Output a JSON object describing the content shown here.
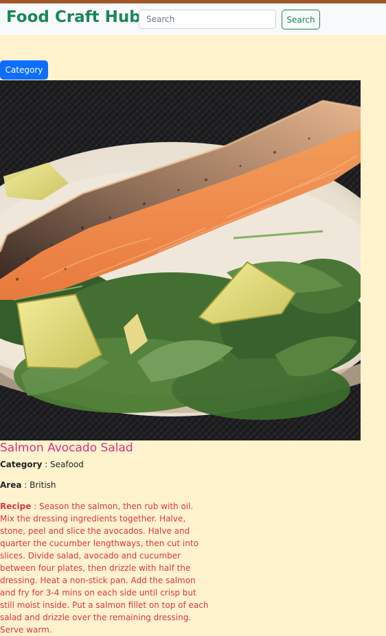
{
  "colors": {
    "page_background": "#fff3cd",
    "navbar_background": "#f8f9fa",
    "top_stripe": "#a0582a",
    "brand": "#198754",
    "primary": "#0d6efd",
    "title": "#d63384",
    "recipe": "#dc3545"
  },
  "navbar": {
    "brand": "Food Craft Hub",
    "search_placeholder": "Search",
    "search_button_label": "Search"
  },
  "category_button_label": "Category",
  "meal": {
    "image_alt": "Salmon Avocado Salad",
    "title": "Salmon Avocado Salad",
    "category_label": "Category",
    "category_value": "Seafood",
    "area_label": "Area",
    "area_value": "British",
    "recipe_label": "Recipe",
    "recipe_text": "Season the salmon, then rub with oil. Mix the dressing ingredients together. Halve, stone, peel and slice the avocados. Halve and quarter the cucumber lengthways, then cut into slices. Divide salad, avocado and cucumber between four plates, then drizzle with half the dressing. Heat a non-stick pan. Add the salmon and fry for 3-4 mins on each side until crisp but still moist inside. Put a salmon fillet on top of each salad and drizzle over the remaining dressing. Serve warm."
  }
}
